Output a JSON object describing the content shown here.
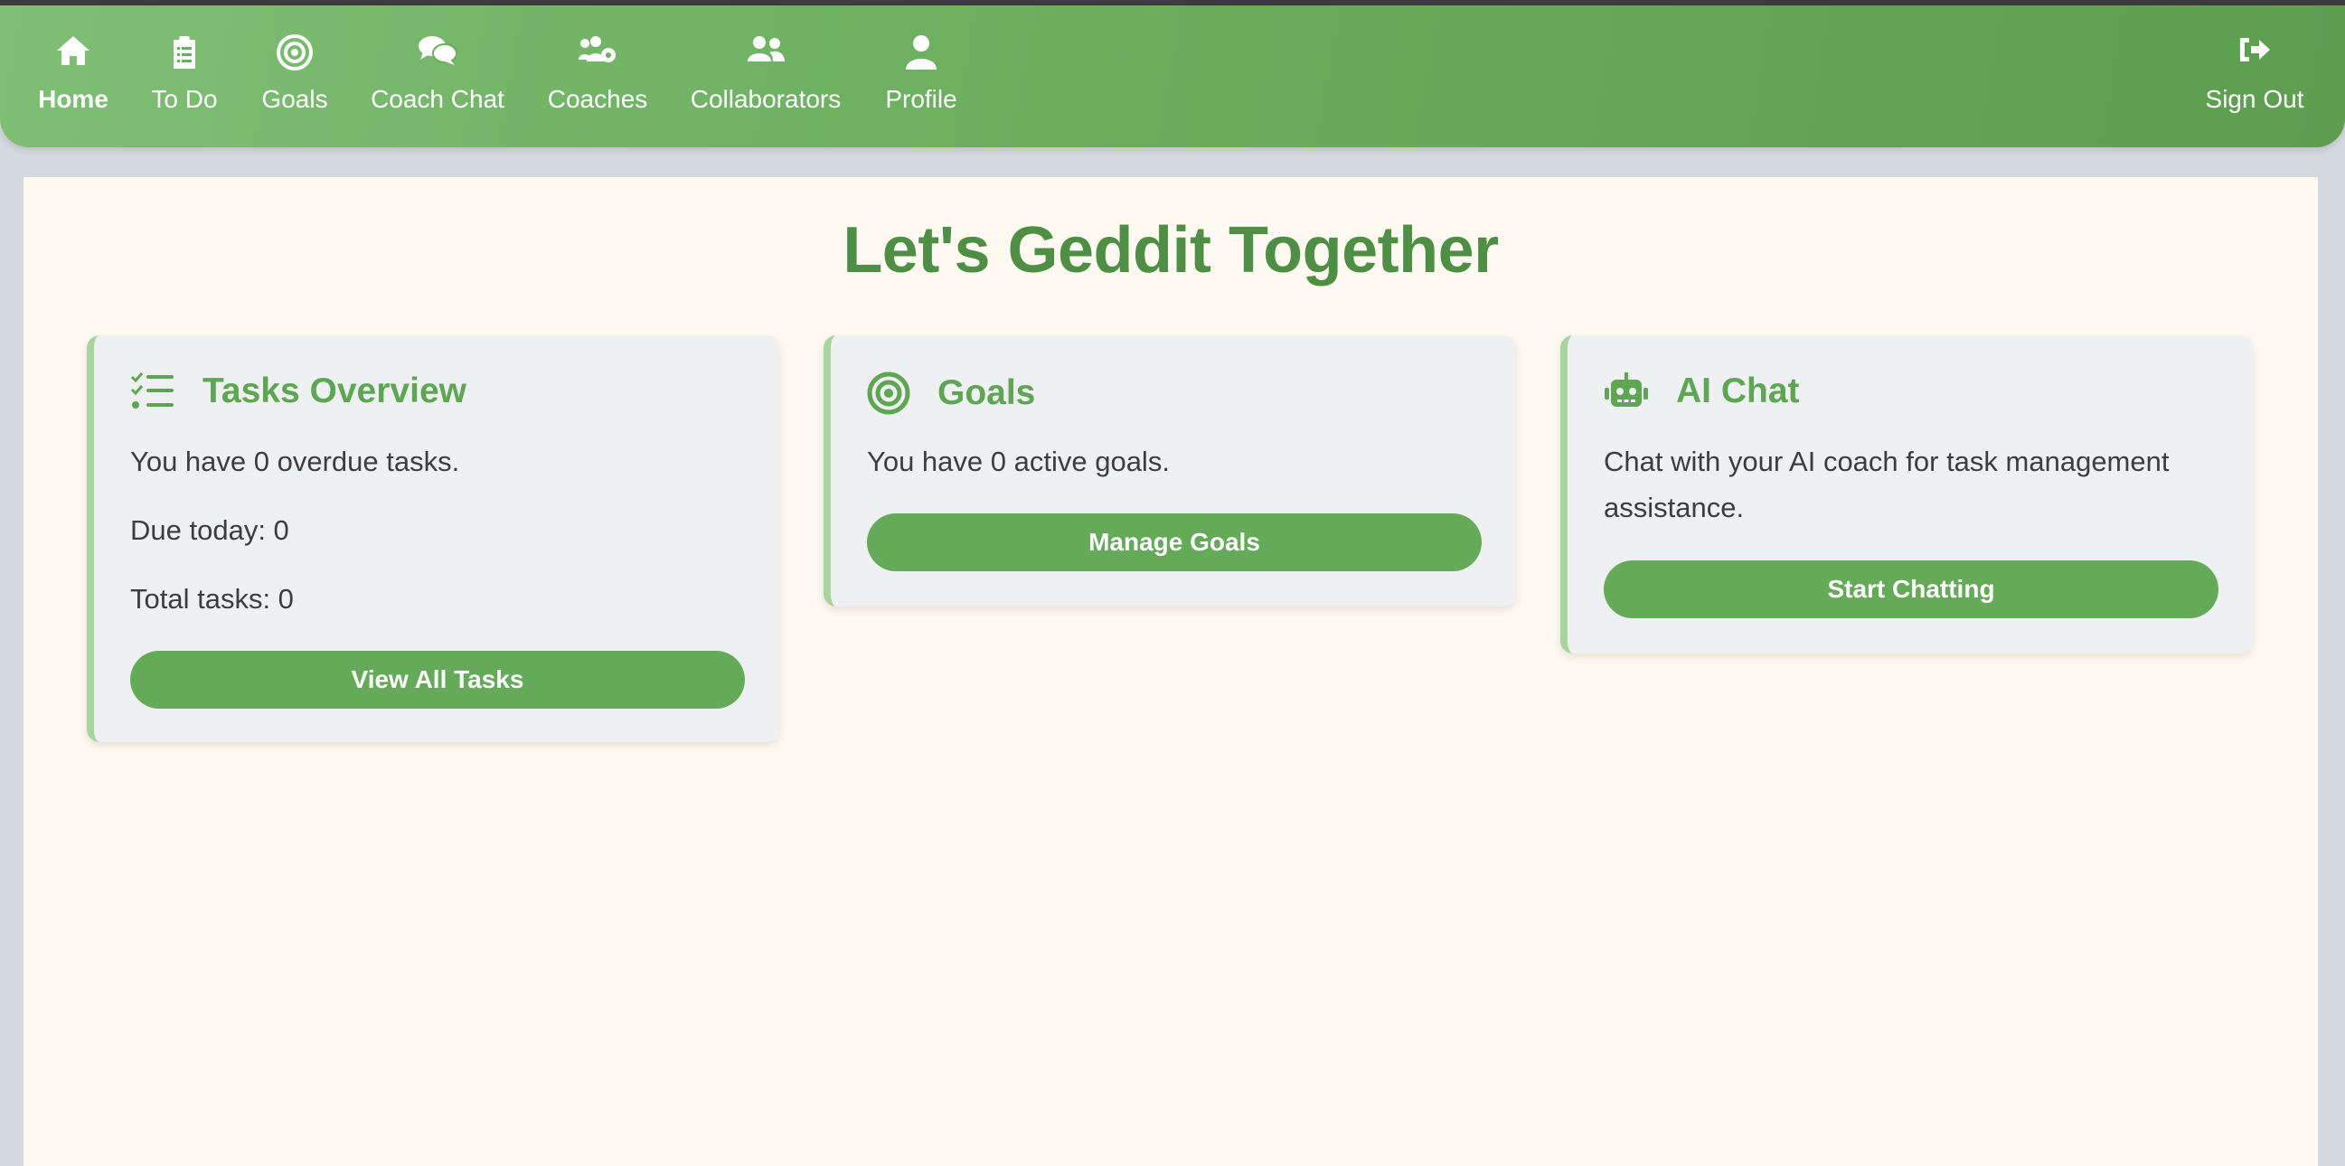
{
  "nav": {
    "items": [
      {
        "label": "Home",
        "icon": "home-icon"
      },
      {
        "label": "To Do",
        "icon": "clipboard-list-icon"
      },
      {
        "label": "Goals",
        "icon": "target-icon"
      },
      {
        "label": "Coach Chat",
        "icon": "comments-icon"
      },
      {
        "label": "Coaches",
        "icon": "users-cog-icon"
      },
      {
        "label": "Collaborators",
        "icon": "user-friends-icon"
      },
      {
        "label": "Profile",
        "icon": "user-icon"
      }
    ],
    "sign_out": {
      "label": "Sign Out",
      "icon": "sign-out-icon"
    },
    "active": "Home"
  },
  "page": {
    "title": "Let's Geddit Together"
  },
  "cards": {
    "tasks": {
      "title": "Tasks Overview",
      "icon": "tasks-list-icon",
      "overdue_text": "You have 0 overdue tasks.",
      "due_today_text": "Due today: 0",
      "total_text": "Total tasks: 0",
      "button": "View All Tasks"
    },
    "goals": {
      "title": "Goals",
      "icon": "target-icon",
      "active_text": "You have 0 active goals.",
      "button": "Manage Goals"
    },
    "ai_chat": {
      "title": "AI Chat",
      "icon": "robot-icon",
      "description": "Chat with your AI coach for task management assistance.",
      "button": "Start Chatting"
    }
  },
  "colors": {
    "nav_gradient_start": "#7fbf74",
    "nav_gradient_end": "#5d9e51",
    "accent": "#5ea653",
    "title": "#4f8f45",
    "button": "#65aa59",
    "card_border": "#a8d49e",
    "page_bg": "#fffaf1"
  }
}
